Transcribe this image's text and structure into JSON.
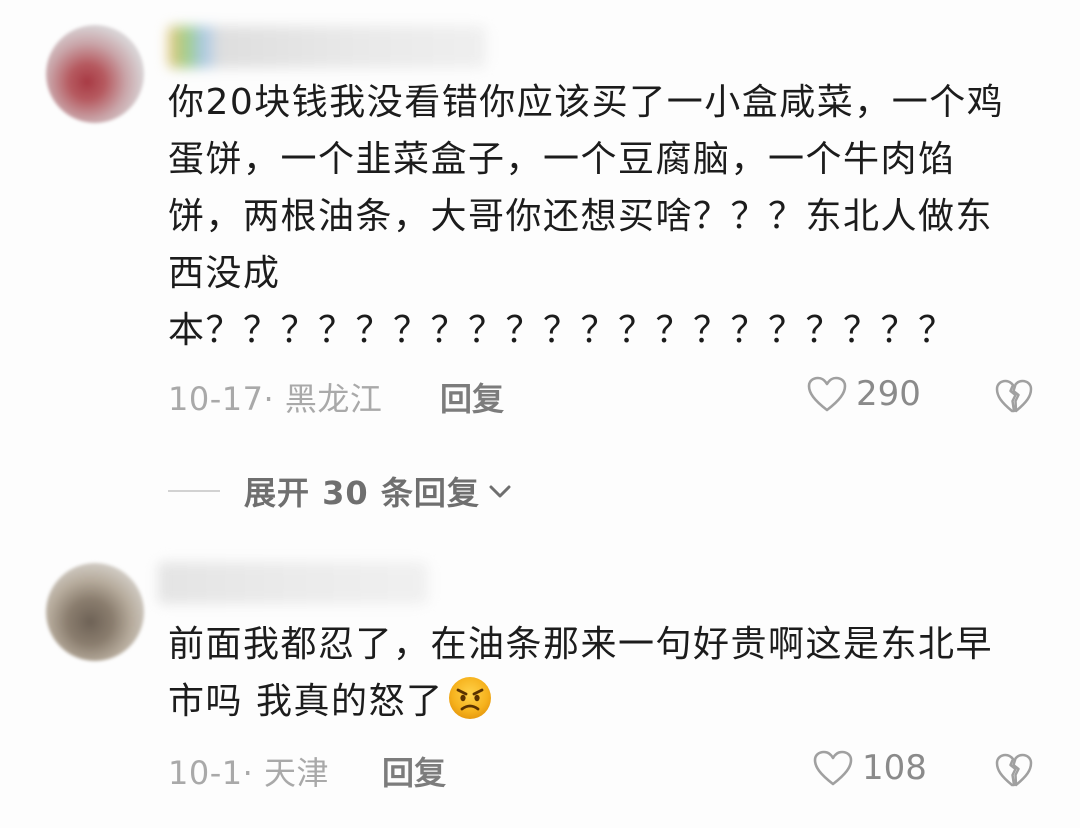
{
  "comments": [
    {
      "text": "你20块钱我没看错你应该买了一小盒咸菜，一个鸡蛋饼，一个韭菜盒子，一个豆腐脑，一个牛肉馅饼，两根油条，大哥你还想买啥？？？东北人做东西没成\n本？？？？？？？？？？？？？？？？？？？？",
      "meta": "10-17· 黑龙江",
      "reply_label": "回复",
      "likes": "290",
      "avatar_icon": "blurred-avatar",
      "like_icon": "heart-outline-icon",
      "dislike_icon": "broken-heart-icon"
    },
    {
      "text": "前面我都忍了，在油条那来一句好贵啊这是东北早市吗 我真的怒了",
      "emoji": "angry-face-emoji",
      "meta": "10-1· 天津",
      "reply_label": "回复",
      "likes": "108",
      "avatar_icon": "blurred-avatar",
      "like_icon": "heart-outline-icon",
      "dislike_icon": "broken-heart-icon"
    }
  ],
  "expand_replies": {
    "label": "展开 30 条回复",
    "icon": "chevron-down-icon"
  },
  "colors": {
    "text": "#1c1c1c",
    "meta": "#a9a9a9",
    "reply": "#7c7c7c",
    "icon": "#a0a0a0"
  }
}
